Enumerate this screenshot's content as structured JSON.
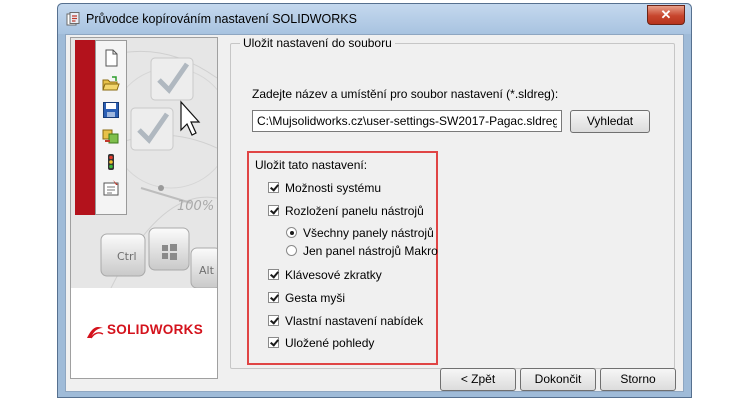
{
  "window": {
    "title": "Průvodce kopírováním nastavení SOLIDWORKS",
    "close_symbol": "✕"
  },
  "sidebar": {
    "toolbar_icons": [
      "new-document-icon",
      "open-folder-icon",
      "save-icon",
      "copy-settings-icon",
      "traffic-light-icon",
      "properties-icon"
    ],
    "art_text": {
      "key_ctrl": "Ctrl",
      "key_alt": "Alt",
      "zoom": "100%"
    },
    "logo_text": "SOLIDWORKS",
    "logo_color": "#d4121c"
  },
  "group": {
    "legend": "Uložit nastavení do souboru",
    "prompt": "Zadejte název a umístění pro soubor nastavení (*.sldreg):",
    "path_value": "C:\\Mujsolidworks.cz\\user-settings-SW2017-Pagac.sldreg",
    "browse_label": "Vyhledat"
  },
  "settings": {
    "section_label": "Uložit tato nastavení:",
    "highlight_color": "#e04545",
    "system_options": {
      "label": "Možnosti systému",
      "checked": true
    },
    "toolbar_layout": {
      "label": "Rozložení panelu nástrojů",
      "checked": true
    },
    "all_toolbars": {
      "label": "Všechny panely nástrojů",
      "selected": true
    },
    "macro_toolbar": {
      "label": "Jen panel nástrojů Makro",
      "selected": false
    },
    "keyboard_shortcuts": {
      "label": "Klávesové zkratky",
      "checked": true
    },
    "mouse_gestures": {
      "label": "Gesta myši",
      "checked": true
    },
    "menu_customization": {
      "label": "Vlastní nastavení nabídek",
      "checked": true
    },
    "saved_views": {
      "label": "Uložené pohledy",
      "checked": true
    }
  },
  "footer": {
    "back_label": "< Zpět",
    "finish_label": "Dokončit",
    "cancel_label": "Storno"
  }
}
